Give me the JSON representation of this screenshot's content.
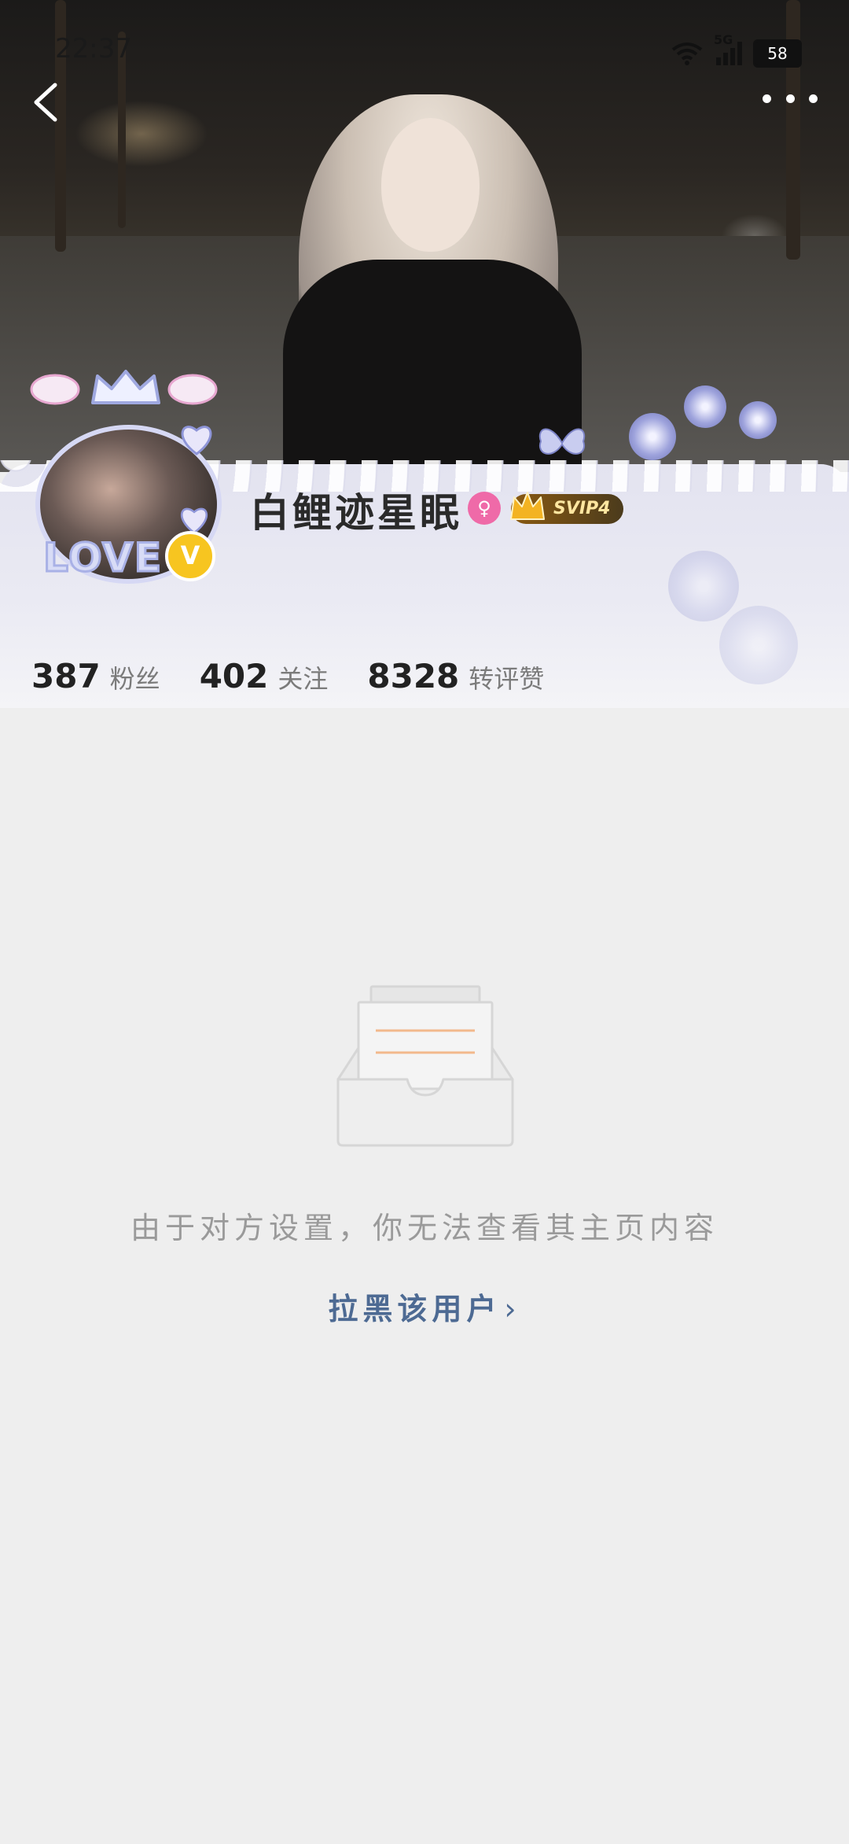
{
  "status_bar": {
    "time": "22:37",
    "network": "5G",
    "battery": "58"
  },
  "profile": {
    "username": "白鲤迹星眠",
    "avatar_frame_text": "LOVE",
    "verified_mark": "V",
    "gender_icon": "♀",
    "vip_label": "SVIP4",
    "stats": {
      "followers_count": "387",
      "followers_label": "粉丝",
      "following_count": "402",
      "following_label": "关注",
      "interactions_count": "8328",
      "interactions_label": "转评赞"
    }
  },
  "empty_state": {
    "message": "由于对方设置，你无法查看其主页内容",
    "block_link": "拉黑该用户"
  },
  "colors": {
    "background": "#eeeeee",
    "link": "#4d6a93",
    "vip_gold": "#ffe6a0",
    "verified": "#f7c520"
  }
}
